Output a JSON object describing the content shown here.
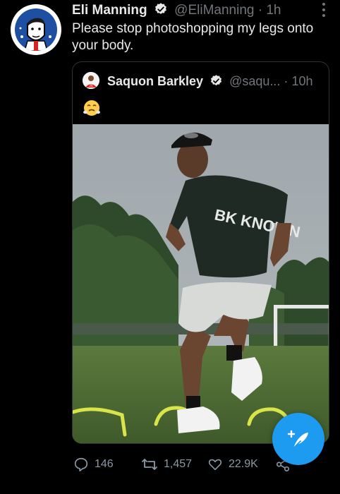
{
  "tweet": {
    "author_name": "Eli Manning",
    "author_handle": "@EliManning",
    "separator": "·",
    "time": "1h",
    "text": "Please stop photoshopping my legs onto your body."
  },
  "quote": {
    "author_name": "Saquon Barkley",
    "author_handle": "@saqu...",
    "separator": "·",
    "time": "10h",
    "emoji": "face-with-steam-from-nose",
    "photo_shirt_text": "BK KNOWN"
  },
  "actions": {
    "replies": "146",
    "retweets": "1,457",
    "likes": "22.9K"
  },
  "colors": {
    "background": "#000000",
    "text": "#e7e9ea",
    "muted": "#71767b",
    "accent": "#1d9bf0"
  }
}
